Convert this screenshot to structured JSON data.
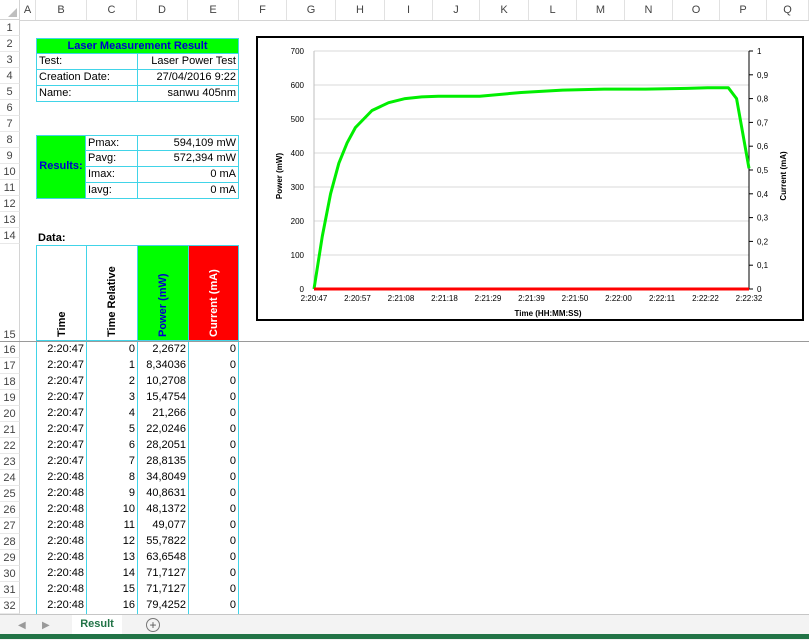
{
  "columns": [
    "A",
    "B",
    "C",
    "D",
    "E",
    "F",
    "G",
    "H",
    "I",
    "J",
    "K",
    "L",
    "M",
    "N",
    "O",
    "P",
    "Q"
  ],
  "rows": [
    "1",
    "2",
    "3",
    "4",
    "5",
    "6",
    "7",
    "8",
    "9",
    "10",
    "11",
    "12",
    "13",
    "14",
    "15",
    "16",
    "17",
    "18",
    "19",
    "20",
    "21",
    "22",
    "23",
    "24",
    "25",
    "26",
    "27",
    "28",
    "29",
    "30",
    "31",
    "32"
  ],
  "title": "Laser Measurement Result",
  "info": [
    {
      "label": "Test:",
      "value": "Laser Power Test"
    },
    {
      "label": "Creation Date:",
      "value": "27/04/2016 9:22"
    },
    {
      "label": "Name:",
      "value": "sanwu 405nm"
    }
  ],
  "results_label": "Results:",
  "results": [
    {
      "label": "Pmax:",
      "value": "594,109 mW"
    },
    {
      "label": "Pavg:",
      "value": "572,394 mW"
    },
    {
      "label": "Imax:",
      "value": "0 mA"
    },
    {
      "label": "Iavg:",
      "value": "0 mA"
    }
  ],
  "data_label": "Data:",
  "data_headers": {
    "time": "Time",
    "rel": "Time Relative",
    "power": "Power (mW)",
    "current": "Current (mA)"
  },
  "data_rows": [
    [
      "2:20:47",
      "0",
      "2,2672",
      "0"
    ],
    [
      "2:20:47",
      "1",
      "8,34036",
      "0"
    ],
    [
      "2:20:47",
      "2",
      "10,2708",
      "0"
    ],
    [
      "2:20:47",
      "3",
      "15,4754",
      "0"
    ],
    [
      "2:20:47",
      "4",
      "21,266",
      "0"
    ],
    [
      "2:20:47",
      "5",
      "22,0246",
      "0"
    ],
    [
      "2:20:47",
      "6",
      "28,2051",
      "0"
    ],
    [
      "2:20:47",
      "7",
      "28,8135",
      "0"
    ],
    [
      "2:20:48",
      "8",
      "34,8049",
      "0"
    ],
    [
      "2:20:48",
      "9",
      "40,8631",
      "0"
    ],
    [
      "2:20:48",
      "10",
      "48,1372",
      "0"
    ],
    [
      "2:20:48",
      "11",
      "49,077",
      "0"
    ],
    [
      "2:20:48",
      "12",
      "55,7822",
      "0"
    ],
    [
      "2:20:48",
      "13",
      "63,6548",
      "0"
    ],
    [
      "2:20:48",
      "14",
      "71,7127",
      "0"
    ],
    [
      "2:20:48",
      "15",
      "71,7127",
      "0"
    ],
    [
      "2:20:48",
      "16",
      "79,4252",
      "0"
    ]
  ],
  "colors": {
    "green": "#00ff00",
    "red": "#ff0000",
    "title_text": "#0000cc",
    "cyan_border": "#41d4e8",
    "excel_green": "#217346"
  },
  "sheet_tab": "Result",
  "add_sheet_icon": "plus-circle-icon",
  "chart_data": {
    "type": "line",
    "xlabel": "Time (HH:MM:SS)",
    "ylabel": "Power (mW)",
    "y2label": "Current (mA)",
    "x_ticks": [
      "2:20:47",
      "2:20:57",
      "2:21:08",
      "2:21:18",
      "2:21:29",
      "2:21:39",
      "2:21:50",
      "2:22:00",
      "2:22:11",
      "2:22:22",
      "2:22:32"
    ],
    "ylim": [
      0,
      700
    ],
    "y_ticks": [
      "0",
      "100",
      "200",
      "300",
      "400",
      "500",
      "600",
      "700"
    ],
    "y2lim": [
      0,
      1
    ],
    "y2_ticks": [
      "0",
      "0,1",
      "0,2",
      "0,3",
      "0,4",
      "0,5",
      "0,6",
      "0,7",
      "0,8",
      "0,9",
      "1"
    ],
    "grid": true,
    "series": [
      {
        "color": "#00ee00",
        "axis": "left",
        "t": [
          0,
          2,
          4,
          6,
          8,
          10,
          14,
          18,
          22,
          26,
          30,
          40,
          50,
          60,
          70,
          80,
          90,
          95,
          100,
          102,
          105
        ],
        "values": [
          0,
          155,
          280,
          370,
          430,
          475,
          525,
          548,
          560,
          565,
          567,
          567,
          578,
          585,
          588,
          588,
          590,
          592,
          592,
          560,
          355
        ]
      },
      {
        "color": "#ff0000",
        "axis": "right",
        "t": [
          0,
          105
        ],
        "values": [
          0,
          0
        ]
      }
    ],
    "x_max": 105
  }
}
